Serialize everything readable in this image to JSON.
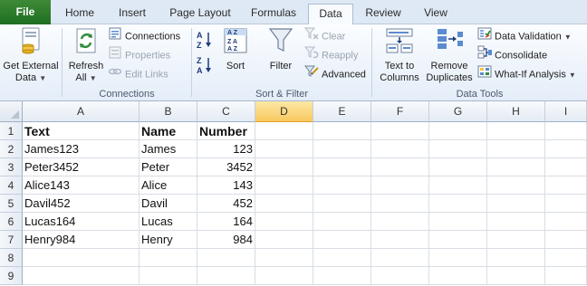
{
  "tabs": [
    {
      "label": "File",
      "key": "file"
    },
    {
      "label": "Home",
      "key": "home"
    },
    {
      "label": "Insert",
      "key": "insert"
    },
    {
      "label": "Page Layout",
      "key": "page-layout"
    },
    {
      "label": "Formulas",
      "key": "formulas"
    },
    {
      "label": "Data",
      "key": "data",
      "active": true
    },
    {
      "label": "Review",
      "key": "review"
    },
    {
      "label": "View",
      "key": "view"
    }
  ],
  "ribbon": {
    "get_external": {
      "line1": "Get External",
      "line2": "Data"
    },
    "connections": {
      "refresh_line1": "Refresh",
      "refresh_line2": "All",
      "connections": "Connections",
      "properties": "Properties",
      "edit_links": "Edit Links",
      "label": "Connections"
    },
    "sort_filter": {
      "sort": "Sort",
      "filter": "Filter",
      "clear": "Clear",
      "reapply": "Reapply",
      "advanced": "Advanced",
      "label": "Sort & Filter"
    },
    "data_tools": {
      "text_to_line1": "Text to",
      "text_to_line2": "Columns",
      "remove_line1": "Remove",
      "remove_line2": "Duplicates",
      "data_validation": "Data Validation",
      "consolidate": "Consolidate",
      "what_if": "What-If Analysis",
      "label": "Data Tools"
    }
  },
  "sheet": {
    "columns": [
      "A",
      "B",
      "C",
      "D",
      "E",
      "F",
      "G",
      "H",
      "I"
    ],
    "selected_column": "D",
    "row_numbers": [
      "1",
      "2",
      "3",
      "4",
      "5",
      "6",
      "7",
      "8",
      "9"
    ],
    "header": {
      "text": "Text",
      "name": "Name",
      "number": "Number"
    },
    "rows": [
      {
        "text": "James123",
        "name": "James",
        "number": "123"
      },
      {
        "text": "Peter3452",
        "name": "Peter",
        "number": "3452"
      },
      {
        "text": "Alice143",
        "name": "Alice",
        "number": "143"
      },
      {
        "text": "Davil452",
        "name": "Davil",
        "number": "452"
      },
      {
        "text": "Lucas164",
        "name": "Lucas",
        "number": "164"
      },
      {
        "text": "Henry984",
        "name": "Henry",
        "number": "984"
      }
    ]
  },
  "colors": {
    "file_tab": "#2a7a2a",
    "ribbon_bg": "#e4edf8",
    "selected_column": "#f7c85e",
    "grid_line": "#d8dde4"
  }
}
